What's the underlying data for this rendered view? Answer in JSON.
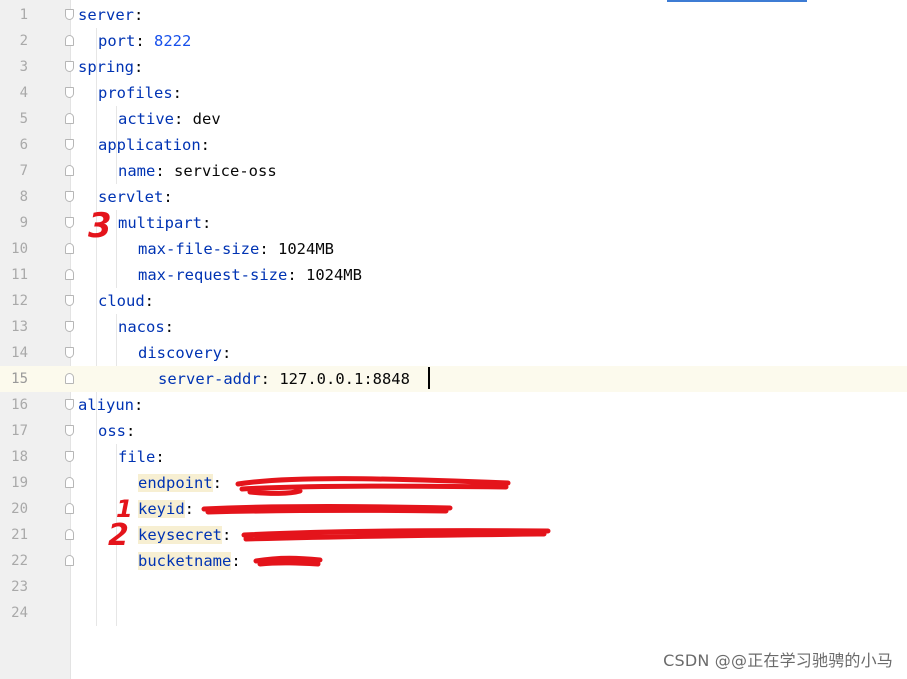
{
  "editor": {
    "lines": [
      {
        "n": "1",
        "indent": 0,
        "key": "server",
        "sep": ":"
      },
      {
        "n": "2",
        "indent": 1,
        "key": "port",
        "sep": ": ",
        "value": "8222",
        "vtype": "num"
      },
      {
        "n": "3",
        "indent": 0,
        "key": "spring",
        "sep": ":"
      },
      {
        "n": "4",
        "indent": 1,
        "key": "profiles",
        "sep": ":"
      },
      {
        "n": "5",
        "indent": 2,
        "key": "active",
        "sep": ": ",
        "value": "dev"
      },
      {
        "n": "6",
        "indent": 1,
        "key": "application",
        "sep": ":"
      },
      {
        "n": "7",
        "indent": 2,
        "key": "name",
        "sep": ": ",
        "value": "service-oss"
      },
      {
        "n": "8",
        "indent": 1,
        "key": "servlet",
        "sep": ":"
      },
      {
        "n": "9",
        "indent": 2,
        "key": "multipart",
        "sep": ":"
      },
      {
        "n": "10",
        "indent": 3,
        "key": "max-file-size",
        "sep": ": ",
        "value": "1024MB"
      },
      {
        "n": "11",
        "indent": 3,
        "key": "max-request-size",
        "sep": ": ",
        "value": "1024MB"
      },
      {
        "n": "12",
        "indent": 1,
        "key": "cloud",
        "sep": ":"
      },
      {
        "n": "13",
        "indent": 2,
        "key": "nacos",
        "sep": ":"
      },
      {
        "n": "14",
        "indent": 3,
        "key": "discovery",
        "sep": ":"
      },
      {
        "n": "15",
        "indent": 4,
        "key": "server-addr",
        "sep": ": ",
        "value": "127.0.0.1:8848",
        "current": true
      },
      {
        "n": "16",
        "indent": 0,
        "key": "aliyun",
        "sep": ":"
      },
      {
        "n": "17",
        "indent": 1,
        "key": "oss",
        "sep": ":"
      },
      {
        "n": "18",
        "indent": 2,
        "key": "file",
        "sep": ":"
      },
      {
        "n": "19",
        "indent": 3,
        "key": "endpoint",
        "sep": ": ",
        "value": "",
        "highlight": true
      },
      {
        "n": "20",
        "indent": 3,
        "key": "keyid",
        "sep": ": ",
        "value": "",
        "highlight": true
      },
      {
        "n": "21",
        "indent": 3,
        "key": "keysecret",
        "sep": ": ",
        "value": "",
        "highlight": true
      },
      {
        "n": "22",
        "indent": 3,
        "key": "bucketname",
        "sep": ": ",
        "value": "",
        "highlight": true
      },
      {
        "n": "23",
        "indent": 0
      },
      {
        "n": "24",
        "indent": 0
      }
    ]
  },
  "annotations": {
    "one": "1",
    "two": "2",
    "three": "3"
  },
  "watermark": "CSDN @@正在学习驰骋的小马",
  "colors": {
    "key": "#0033b3",
    "number": "#1750eb",
    "annotation": "#e4141b",
    "current_line": "#fcfaed"
  }
}
